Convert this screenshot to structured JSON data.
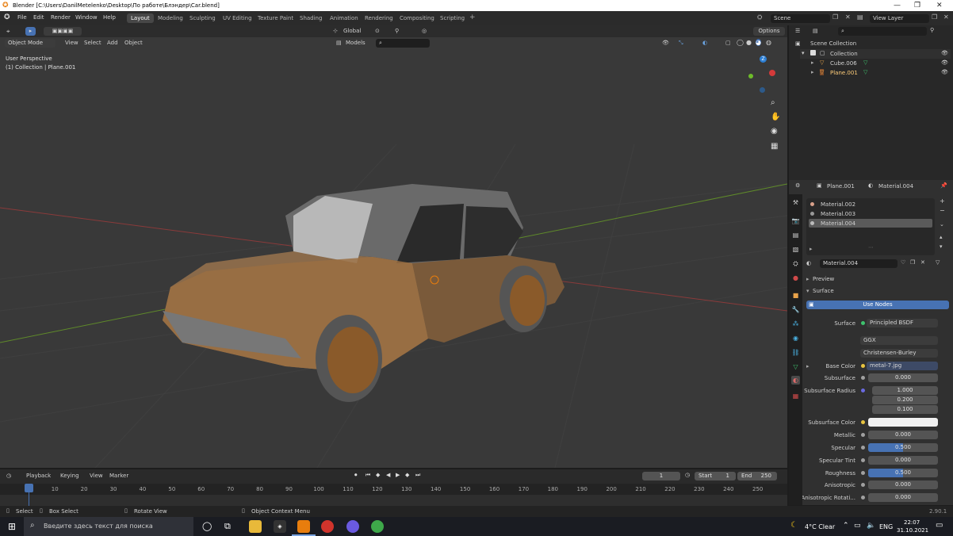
{
  "window": {
    "title": "Blender [C:\\Users\\DanilMetelenko\\Desktop\\По работе\\Блэндер\\Car.blend]"
  },
  "menu": [
    "File",
    "Edit",
    "Render",
    "Window",
    "Help"
  ],
  "workspaces": [
    "Layout",
    "Modeling",
    "Sculpting",
    "UV Editing",
    "Texture Paint",
    "Shading",
    "Animation",
    "Rendering",
    "Compositing",
    "Scripting"
  ],
  "scene": {
    "label": "Scene",
    "view_layer": "View Layer"
  },
  "viewport": {
    "orientation": "Global",
    "options": "Options",
    "mode": "Object Mode",
    "view_menu": [
      "View",
      "Select",
      "Add",
      "Object"
    ],
    "collection_filter": "Models",
    "overlay_line1": "User Perspective",
    "overlay_line2": "(1) Collection | Plane.001",
    "gizmo_z": "Z"
  },
  "outliner": {
    "root": "Scene Collection",
    "items": [
      {
        "name": "Collection"
      },
      {
        "name": "Cube.006"
      },
      {
        "name": "Plane.001"
      }
    ]
  },
  "properties": {
    "object": "Plane.001",
    "material_header": "Material.004",
    "slots": [
      "Material.002",
      "Material.003",
      "Material.004"
    ],
    "material_name": "Material.004",
    "preview": "Preview",
    "surface": "Surface",
    "use_nodes": "Use Nodes",
    "surface_label": "Surface",
    "surface_value": "Principled BSDF",
    "distribution": "GGX",
    "subsurface_method": "Christensen-Burley",
    "rows": [
      {
        "label": "Base Color",
        "value": "metal-7.jpg"
      },
      {
        "label": "Subsurface",
        "value": "0.000"
      },
      {
        "label": "Subsurface Radius",
        "value": "1.000"
      },
      {
        "label": "",
        "value": "0.200"
      },
      {
        "label": "",
        "value": "0.100"
      },
      {
        "label": "Subsurface Color",
        "value": ""
      },
      {
        "label": "Metallic",
        "value": "0.000"
      },
      {
        "label": "Specular",
        "value": "0.500"
      },
      {
        "label": "Specular Tint",
        "value": "0.000"
      },
      {
        "label": "Roughness",
        "value": "0.500"
      },
      {
        "label": "Anisotropic",
        "value": "0.000"
      },
      {
        "label": "Anisotropic Rotati...",
        "value": "0.000"
      }
    ]
  },
  "timeline": {
    "menus": [
      "Playback",
      "Keying",
      "View",
      "Marker"
    ],
    "current_frame": "1",
    "start_label": "Start",
    "start": "1",
    "end_label": "End",
    "end": "250",
    "ticks": [
      "1",
      "10",
      "20",
      "30",
      "40",
      "50",
      "60",
      "70",
      "80",
      "90",
      "100",
      "110",
      "120",
      "130",
      "140",
      "150",
      "160",
      "170",
      "180",
      "190",
      "200",
      "210",
      "220",
      "230",
      "240",
      "250"
    ]
  },
  "status": {
    "select": "Select",
    "box_select": "Box Select",
    "rotate_view": "Rotate View",
    "context_menu": "Object Context Menu",
    "version": "2.90.1"
  },
  "taskbar": {
    "search_placeholder": "Введите здесь текст для поиска",
    "weather": "4°C  Clear",
    "lang": "ENG",
    "time": "22:07",
    "date": "31.10.2021"
  }
}
